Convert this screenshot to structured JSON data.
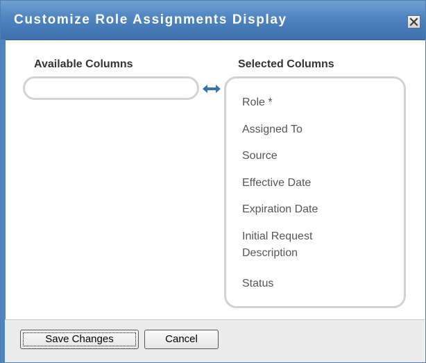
{
  "dialog": {
    "title": "Customize Role Assignments Display",
    "close_icon": "close-icon"
  },
  "available": {
    "heading": "Available Columns",
    "items": []
  },
  "transfer": {
    "icon": "swap-arrows-icon"
  },
  "selected": {
    "heading": "Selected Columns",
    "items": [
      {
        "label": "Role *"
      },
      {
        "label": "Assigned To"
      },
      {
        "label": "Source"
      },
      {
        "label": "Effective Date"
      },
      {
        "label": "Expiration Date"
      },
      {
        "label": "Initial Request\nDescription"
      },
      {
        "label": "Status"
      }
    ]
  },
  "footer": {
    "save_label": "Save Changes",
    "cancel_label": "Cancel"
  },
  "colors": {
    "titlebar": "#4f84c0",
    "accent_arrow": "#3a6fb0",
    "list_border": "#d2d2d2"
  }
}
